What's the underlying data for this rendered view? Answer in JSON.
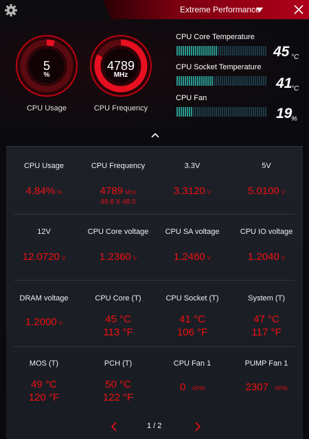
{
  "header": {
    "mode_label": "Extreme Performance",
    "icons": {
      "settings": "gear-icon",
      "dropdown": "triangle-down-icon",
      "close": "close-icon"
    }
  },
  "gauges": [
    {
      "id": "cpu-usage",
      "value": "5",
      "unit": "%",
      "title": "CPU Usage",
      "fill_fraction": 0.05
    },
    {
      "id": "cpu-frequency",
      "value": "4789",
      "unit": "MHz",
      "title": "CPU Frequency",
      "fill_fraction": 0.82
    }
  ],
  "stats": [
    {
      "label": "CPU Core Temperature",
      "value": "45",
      "unit": "°C",
      "level": 0.45
    },
    {
      "label": "CPU Socket Temperature",
      "value": "41",
      "unit": "°C",
      "level": 0.41
    },
    {
      "label": "CPU Fan",
      "value": "19",
      "unit": "%",
      "level": 0.19
    }
  ],
  "grid": {
    "row1": [
      {
        "label": "CPU Usage",
        "value": "4.84%",
        "unit": "%"
      },
      {
        "label": "CPU Frequency",
        "value": "4789",
        "unit": "MHz",
        "sub": "99.8 X 48.0"
      },
      {
        "label": "3.3V",
        "value": "3.3120",
        "unit": "V"
      },
      {
        "label": "5V",
        "value": "5.0100",
        "unit": "V"
      }
    ],
    "row2": [
      {
        "label": "12V",
        "value": "12.0720",
        "unit": "V"
      },
      {
        "label": "CPU Core voltage",
        "value": "1.2360",
        "unit": "V"
      },
      {
        "label": "CPU SA voltage",
        "value": "1.2460",
        "unit": "V"
      },
      {
        "label": "CPU IO voltage",
        "value": "1.2040",
        "unit": "V"
      }
    ],
    "row3": [
      {
        "label": "DRAM voltage",
        "value": "1.2000",
        "unit": "V"
      },
      {
        "label": "CPU Core (T)",
        "value": "45 °C",
        "sub": "113 °F"
      },
      {
        "label": "CPU Socket (T)",
        "value": "41 °C",
        "sub": "106 °F"
      },
      {
        "label": "System (T)",
        "value": "47 °C",
        "sub": "117 °F"
      }
    ],
    "row4": [
      {
        "label": "MOS (T)",
        "value": "49 °C",
        "sub": "120 °F"
      },
      {
        "label": "PCH (T)",
        "value": "50 °C",
        "sub": "122 °F"
      },
      {
        "label": "CPU Fan 1",
        "value": "0",
        "unit": "RPM"
      },
      {
        "label": "PUMP Fan 1",
        "value": "2307",
        "unit": "RPM"
      }
    ]
  },
  "pager": {
    "text": "1 / 2"
  },
  "colors": {
    "accent": "#e01010",
    "bg": "#0b0b0f",
    "panel": "#1e2028",
    "teal": "#2a9a90"
  }
}
